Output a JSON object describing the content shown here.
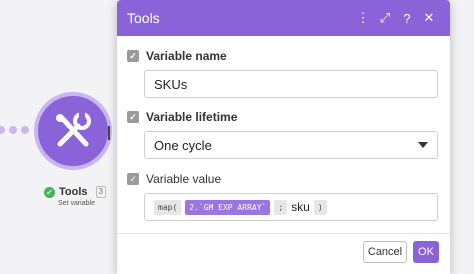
{
  "canvas": {
    "module_name": "Tools",
    "module_number": "3",
    "module_subtitle": "Set variable"
  },
  "dialog": {
    "title": "Tools",
    "fields": {
      "variable_name": {
        "label": "Variable name",
        "value": "SKUs"
      },
      "variable_lifetime": {
        "label": "Variable lifetime",
        "value": "One cycle"
      },
      "variable_value": {
        "label": "Variable value",
        "tokens": [
          "map(",
          "2.`GM EXP ARRAY`",
          ";",
          "sku",
          ")"
        ]
      }
    },
    "buttons": {
      "cancel": "Cancel",
      "ok": "OK"
    }
  },
  "colors": {
    "accent": "#8b63d9",
    "success": "#3fb45a"
  },
  "icons": [
    "more-vertical-icon",
    "expand-icon",
    "help-icon",
    "close-icon",
    "wrench-screwdriver-icon",
    "checkbox-icon",
    "chevron-down-icon"
  ]
}
